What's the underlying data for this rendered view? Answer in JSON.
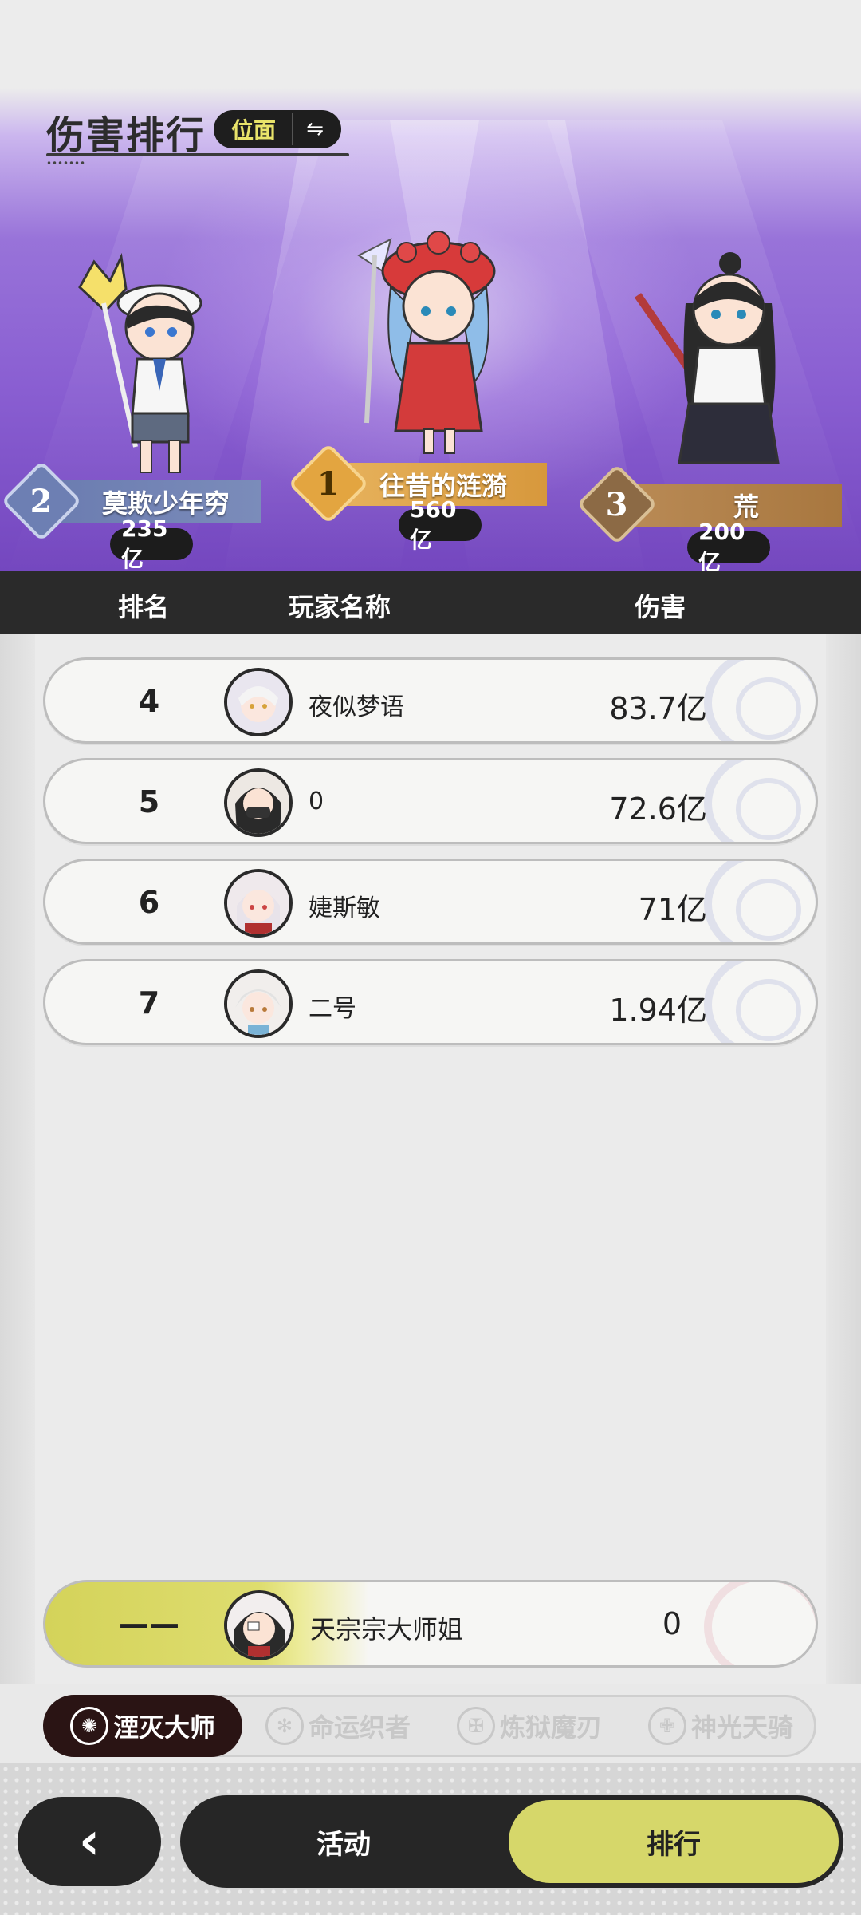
{
  "header": {
    "title": "伤害排行",
    "view_toggle_label": "位面",
    "swap_icon": "swap-arrows-icon"
  },
  "podium": [
    {
      "rank": "1",
      "name": "往昔的涟漪",
      "score": "560亿"
    },
    {
      "rank": "2",
      "name": "莫欺少年穷",
      "score": "235亿"
    },
    {
      "rank": "3",
      "name": "荒",
      "score": "200亿"
    }
  ],
  "table": {
    "headers": {
      "rank": "排名",
      "name": "玩家名称",
      "damage": "伤害"
    },
    "rows": [
      {
        "rank": "4",
        "name": "夜似梦语",
        "damage": "83.7亿"
      },
      {
        "rank": "5",
        "name": "0",
        "damage": "72.6亿"
      },
      {
        "rank": "6",
        "name": "婕斯敏",
        "damage": "71亿"
      },
      {
        "rank": "7",
        "name": "二号",
        "damage": "1.94亿"
      }
    ],
    "self": {
      "rank": "——",
      "name": "天宗宗大师姐",
      "damage": "0"
    }
  },
  "tabs": [
    {
      "label": "湮灭大师",
      "icon": "annihilation-emblem-icon",
      "active": true
    },
    {
      "label": "命运织者",
      "icon": "fate-weaver-emblem-icon",
      "active": false
    },
    {
      "label": "炼狱魔刃",
      "icon": "purgatory-blade-emblem-icon",
      "active": false
    },
    {
      "label": "神光天骑",
      "icon": "divine-rider-emblem-icon",
      "active": false
    }
  ],
  "bottom_nav": {
    "back_icon": "chevron-left-icon",
    "activity_label": "活动",
    "ranking_label": "排行"
  },
  "colors": {
    "accent_yellow": "#d6d76a",
    "dark": "#262626",
    "banner_purple": "#8a5fd2",
    "gold": "#e3a540",
    "silver": "#6d7fb3",
    "bronze": "#8c6a45"
  }
}
